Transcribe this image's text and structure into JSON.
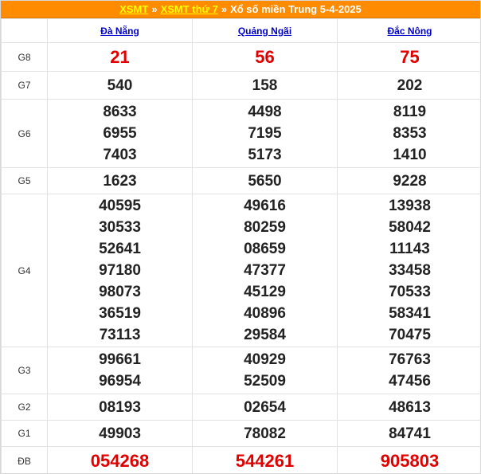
{
  "header": {
    "link1": "XSMT",
    "sep1": "»",
    "link2": "XSMT thứ 7",
    "sep2": "»",
    "title": "Xổ số miền Trung 5-4-2025"
  },
  "provinces": [
    "Đà Nẵng",
    "Quảng Ngãi",
    "Đắc Nông"
  ],
  "prizes": [
    {
      "label": "G8",
      "values": [
        [
          "21"
        ],
        [
          "56"
        ],
        [
          "75"
        ]
      ]
    },
    {
      "label": "G7",
      "values": [
        [
          "540"
        ],
        [
          "158"
        ],
        [
          "202"
        ]
      ]
    },
    {
      "label": "G6",
      "values": [
        [
          "8633",
          "6955",
          "7403"
        ],
        [
          "4498",
          "7195",
          "5173"
        ],
        [
          "8119",
          "8353",
          "1410"
        ]
      ]
    },
    {
      "label": "G5",
      "values": [
        [
          "1623"
        ],
        [
          "5650"
        ],
        [
          "9228"
        ]
      ]
    },
    {
      "label": "G4",
      "values": [
        [
          "40595",
          "30533",
          "52641",
          "97180",
          "98073",
          "36519",
          "73113"
        ],
        [
          "49616",
          "80259",
          "08659",
          "47377",
          "45129",
          "40896",
          "29584"
        ],
        [
          "13938",
          "58042",
          "11143",
          "33458",
          "70533",
          "58341",
          "70475"
        ]
      ]
    },
    {
      "label": "G3",
      "values": [
        [
          "99661",
          "96954"
        ],
        [
          "40929",
          "52509"
        ],
        [
          "76763",
          "47456"
        ]
      ]
    },
    {
      "label": "G2",
      "values": [
        [
          "08193"
        ],
        [
          "02654"
        ],
        [
          "48613"
        ]
      ]
    },
    {
      "label": "G1",
      "values": [
        [
          "49903"
        ],
        [
          "78082"
        ],
        [
          "84741"
        ]
      ]
    },
    {
      "label": "ĐB",
      "values": [
        [
          "054268"
        ],
        [
          "544261"
        ],
        [
          "905803"
        ]
      ]
    }
  ],
  "colors": {
    "header_bg": "#ff8c00",
    "header_link": "#ffff00",
    "province_link": "#0000cc",
    "highlight_red": "#e00000"
  }
}
